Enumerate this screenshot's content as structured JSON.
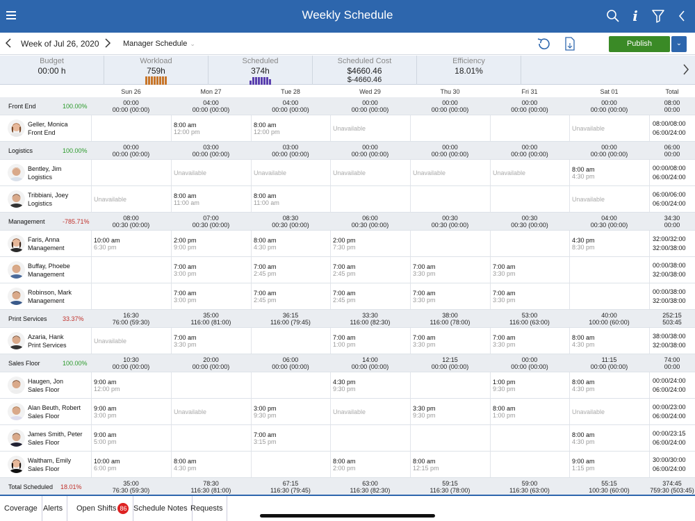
{
  "header": {
    "title": "Weekly Schedule"
  },
  "subbar": {
    "week": "Week of Jul 26, 2020",
    "schedule": "Manager Schedule",
    "publish": "Publish"
  },
  "summary": [
    {
      "label": "Budget",
      "value": "00:00 h",
      "value2": ""
    },
    {
      "label": "Workload",
      "value": "759h",
      "value2": ""
    },
    {
      "label": "Scheduled",
      "value": "374h",
      "value2": ""
    },
    {
      "label": "Scheduled Cost",
      "value": "$4660.46",
      "value2": "$-4660.46"
    },
    {
      "label": "Efficiency",
      "value": "18.01%",
      "value2": ""
    }
  ],
  "colors": {
    "header": "#2d66ad",
    "publish": "#3a8a26",
    "workload_bars": "#c8762a",
    "scheduled_bars": "#5a3fae",
    "positive": "#2a9a2a",
    "negative": "#c0302a"
  },
  "days": [
    "Sun 26",
    "Mon 27",
    "Tue 28",
    "Wed 29",
    "Thu 30",
    "Fri 31",
    "Sat 01",
    "Total"
  ],
  "sections": [
    {
      "name": "Front End",
      "pct": "100.00%",
      "pct_status": "positive",
      "summary": [
        [
          "00:00",
          "00:00 (00:00)"
        ],
        [
          "04:00",
          "00:00 (00:00)"
        ],
        [
          "04:00",
          "00:00 (00:00)"
        ],
        [
          "00:00",
          "00:00 (00:00)"
        ],
        [
          "00:00",
          "00:00 (00:00)"
        ],
        [
          "00:00",
          "00:00 (00:00)"
        ],
        [
          "00:00",
          "00:00 (00:00)"
        ],
        [
          "08:00",
          "00:00"
        ]
      ],
      "employees": [
        {
          "name": "Geller, Monica",
          "role": "Front End",
          "avatar": "f1",
          "shifts": [
            [],
            [
              "8:00 am",
              "12:00 pm"
            ],
            [
              "8:00 am",
              "12:00 pm"
            ],
            [
              "Unavailable"
            ],
            [],
            [],
            [
              "Unavailable"
            ]
          ],
          "total": [
            "08:00/08:00",
            "06:00/24:00"
          ]
        }
      ]
    },
    {
      "name": "Logistics",
      "pct": "100.00%",
      "pct_status": "positive",
      "summary": [
        [
          "00:00",
          "00:00 (00:00)"
        ],
        [
          "03:00",
          "00:00 (00:00)"
        ],
        [
          "03:00",
          "00:00 (00:00)"
        ],
        [
          "00:00",
          "00:00 (00:00)"
        ],
        [
          "00:00",
          "00:00 (00:00)"
        ],
        [
          "00:00",
          "00:00 (00:00)"
        ],
        [
          "00:00",
          "00:00 (00:00)"
        ],
        [
          "06:00",
          "00:00"
        ]
      ],
      "employees": [
        {
          "name": "Bentley, Jim",
          "role": "Logistics",
          "avatar": "m1",
          "shifts": [
            [],
            [
              "Unavailable"
            ],
            [
              "Unavailable"
            ],
            [
              "Unavailable"
            ],
            [
              "Unavailable"
            ],
            [
              "Unavailable"
            ],
            [
              "8:00 am",
              "4:30 pm"
            ]
          ],
          "total": [
            "00:00/08:00",
            "06:00/24:00"
          ]
        },
        {
          "name": "Tribbiani, Joey",
          "role": "Logistics",
          "avatar": "m2",
          "shifts": [
            [
              "Unavailable"
            ],
            [
              "8:00 am",
              "11:00 am"
            ],
            [
              "8:00 am",
              "11:00 am"
            ],
            [],
            [],
            [],
            [
              "Unavailable"
            ]
          ],
          "total": [
            "06:00/06:00",
            "06:00/24:00"
          ]
        }
      ]
    },
    {
      "name": "Management",
      "pct": "-785.71%",
      "pct_status": "negative",
      "summary": [
        [
          "08:00",
          "00:30 (00:00)"
        ],
        [
          "07:00",
          "00:30 (00:00)"
        ],
        [
          "08:30",
          "00:30 (00:00)"
        ],
        [
          "06:00",
          "00:30 (00:00)"
        ],
        [
          "00:30",
          "00:30 (00:00)"
        ],
        [
          "00:30",
          "00:30 (00:00)"
        ],
        [
          "04:00",
          "00:30 (00:00)"
        ],
        [
          "34:30",
          "00:00"
        ]
      ],
      "employees": [
        {
          "name": "Faris, Anna",
          "role": "Management",
          "avatar": "f2",
          "shifts": [
            [
              "10:00 am",
              "6:30 pm"
            ],
            [
              "2:00 pm",
              "9:00 pm"
            ],
            [
              "8:00 am",
              "4:30 pm"
            ],
            [
              "2:00 pm",
              "7:30 pm"
            ],
            [],
            [],
            [
              "4:30 pm",
              "8:30 pm"
            ]
          ],
          "total": [
            "32:00/32:00",
            "32:00/38:00"
          ]
        },
        {
          "name": "Buffay, Phoebe",
          "role": "Management",
          "avatar": "m3",
          "shifts": [
            [],
            [
              "7:00 am",
              "3:00 pm"
            ],
            [
              "7:00 am",
              "2:45 pm"
            ],
            [
              "7:00 am",
              "2:45 pm"
            ],
            [
              "7:00 am",
              "3:30 pm"
            ],
            [
              "7:00 am",
              "3:30 pm"
            ],
            []
          ],
          "total": [
            "00:00/38:00",
            "32:00/38:00"
          ]
        },
        {
          "name": "Robinson, Mark",
          "role": "Management",
          "avatar": "m4",
          "shifts": [
            [],
            [
              "7:00 am",
              "3:00 pm"
            ],
            [
              "7:00 am",
              "2:45 pm"
            ],
            [
              "7:00 am",
              "2:45 pm"
            ],
            [
              "7:00 am",
              "3:30 pm"
            ],
            [
              "7:00 am",
              "3:30 pm"
            ],
            []
          ],
          "total": [
            "00:00/38:00",
            "32:00/38:00"
          ]
        }
      ]
    },
    {
      "name": "Print Services",
      "pct": "33.37%",
      "pct_status": "negative",
      "summary": [
        [
          "16:30",
          "76:00 (59:30)"
        ],
        [
          "35:00",
          "116:00 (81:00)"
        ],
        [
          "36:15",
          "116:00 (79:45)"
        ],
        [
          "33:30",
          "116:00 (82:30)"
        ],
        [
          "38:00",
          "116:00 (78:00)"
        ],
        [
          "53:00",
          "116:00 (63:00)"
        ],
        [
          "40:00",
          "100:00 (60:00)"
        ],
        [
          "252:15",
          "503:45"
        ]
      ],
      "employees": [
        {
          "name": "Azaria, Hank",
          "role": "Print Services",
          "avatar": "m5",
          "shifts": [
            [
              "Unavailable"
            ],
            [
              "7:00 am",
              "3:30 pm"
            ],
            [],
            [
              "7:00 am",
              "1:00 pm"
            ],
            [
              "7:00 am",
              "3:30 pm"
            ],
            [
              "7:00 am",
              "3:30 pm"
            ],
            [
              "8:00 am",
              "4:30 pm"
            ]
          ],
          "total": [
            "38:00/38:00",
            "32:00/38:00"
          ]
        }
      ]
    },
    {
      "name": "Sales Floor",
      "pct": "100.00%",
      "pct_status": "positive",
      "summary": [
        [
          "10:30",
          "00:00 (00:00)"
        ],
        [
          "20:00",
          "00:00 (00:00)"
        ],
        [
          "06:00",
          "00:00 (00:00)"
        ],
        [
          "14:00",
          "00:00 (00:00)"
        ],
        [
          "12:15",
          "00:00 (00:00)"
        ],
        [
          "00:00",
          "00:00 (00:00)"
        ],
        [
          "11:15",
          "00:00 (00:00)"
        ],
        [
          "74:00",
          "00:00"
        ]
      ],
      "employees": [
        {
          "name": "Haugen, Jon",
          "role": "Sales Floor",
          "avatar": "m6",
          "shifts": [
            [
              "9:00 am",
              "12:00 pm"
            ],
            [],
            [],
            [
              "4:30 pm",
              "9:30 pm"
            ],
            [],
            [
              "1:00 pm",
              "9:30 pm"
            ],
            [
              "8:00 am",
              "4:30 pm"
            ]
          ],
          "total": [
            "00:00/24:00",
            "06:00/24:00"
          ]
        },
        {
          "name": "Alan Beuth, Robert",
          "role": "Sales Floor",
          "avatar": "m7",
          "shifts": [
            [
              "9:00 am",
              "3:00 pm"
            ],
            [
              "Unavailable"
            ],
            [
              "3:00 pm",
              "9:30 pm"
            ],
            [
              "Unavailable"
            ],
            [
              "3:30 pm",
              "9:30 pm"
            ],
            [
              "8:00 am",
              "1:00 pm"
            ],
            [
              "Unavailable"
            ]
          ],
          "total": [
            "00:00/23:00",
            "06:00/24:00"
          ]
        },
        {
          "name": "James Smith, Peter",
          "role": "Sales Floor",
          "avatar": "m8",
          "shifts": [
            [
              "9:00 am",
              "5:00 pm"
            ],
            [],
            [
              "7:00 am",
              "3:15 pm"
            ],
            [],
            [],
            [],
            [
              "8:00 am",
              "4:30 pm"
            ]
          ],
          "total": [
            "00:00/23:15",
            "06:00/24:00"
          ]
        },
        {
          "name": "Waltham, Emily",
          "role": "Sales Floor",
          "avatar": "f3",
          "shifts": [
            [
              "10:00 am",
              "6:00 pm"
            ],
            [
              "8:00 am",
              "4:30 pm"
            ],
            [],
            [
              "8:00 am",
              "2:00 pm"
            ],
            [
              "8:00 am",
              "12:15 pm"
            ],
            [],
            [
              "9:00 am",
              "1:15 pm"
            ]
          ],
          "total": [
            "30:00/30:00",
            "06:00/24:00"
          ]
        }
      ]
    }
  ],
  "total_row": {
    "name": "Total Scheduled",
    "pct": "18.01%",
    "pct_status": "negative",
    "summary": [
      [
        "35:00",
        "76:30 (59:30)"
      ],
      [
        "78:30",
        "116:30 (81:00)"
      ],
      [
        "67:15",
        "116:30 (79:45)"
      ],
      [
        "63:00",
        "116:30 (82:30)"
      ],
      [
        "59:15",
        "116:30 (78:00)"
      ],
      [
        "59:00",
        "116:30 (63:00)"
      ],
      [
        "55:15",
        "100:30 (60:00)"
      ],
      [
        "374:45",
        "759:30 (503:45)"
      ]
    ]
  },
  "tabs": [
    {
      "label": "Coverage"
    },
    {
      "label": "Alerts"
    },
    {
      "label": "Open Shifts",
      "badge": "86"
    },
    {
      "label": "Schedule Notes"
    },
    {
      "label": "Requests"
    }
  ]
}
